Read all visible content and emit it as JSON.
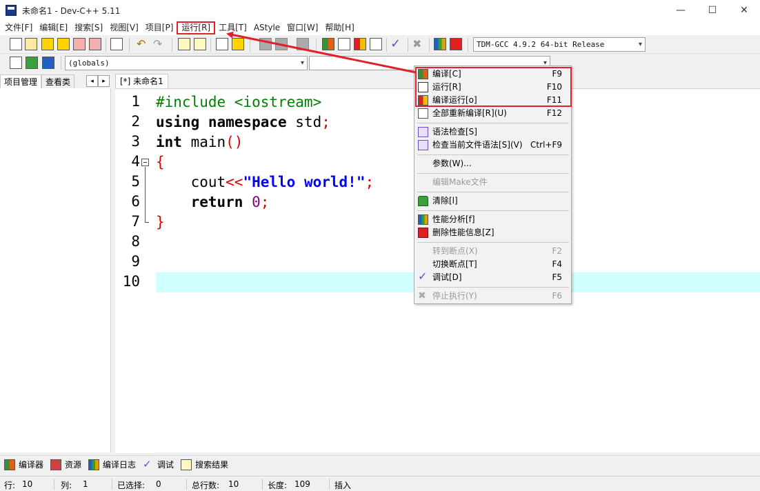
{
  "window": {
    "title": "未命名1 - Dev-C++ 5.11",
    "minimize": "—",
    "maximize": "☐",
    "close": "✕"
  },
  "menu": [
    "文件[F]",
    "编辑[E]",
    "搜索[S]",
    "视图[V]",
    "项目[P]",
    "运行[R]",
    "工具[T]",
    "AStyle",
    "窗口[W]",
    "帮助[H]"
  ],
  "toolbar": {
    "compiler_select": "TDM-GCC 4.9.2 64-bit Release",
    "scope_select": "(globals)",
    "symbol_select": ""
  },
  "left_panel": {
    "tabs": [
      "项目管理",
      "查看类"
    ],
    "prev": "◂",
    "next": "▸"
  },
  "editor": {
    "tab_label": "[*] 未命名1",
    "line_numbers": [
      "1",
      "2",
      "3",
      "4",
      "5",
      "6",
      "7",
      "8",
      "9",
      "10"
    ],
    "active_line": 10
  },
  "run_menu": {
    "items": [
      {
        "label": "编译[C]",
        "shortcut": "F9",
        "icon": "compile-icon",
        "enabled": true
      },
      {
        "label": "运行[R]",
        "shortcut": "F10",
        "icon": "run-icon",
        "enabled": true
      },
      {
        "label": "编译运行[o]",
        "shortcut": "F11",
        "icon": "compile-run-icon",
        "enabled": true
      },
      {
        "label": "全部重新编译[R](U)",
        "shortcut": "F12",
        "icon": "rebuild-all-icon",
        "enabled": true
      },
      {
        "label": "语法检查[S]",
        "shortcut": "",
        "icon": "syntax-check-icon",
        "enabled": true
      },
      {
        "label": "检查当前文件语法[S](V)",
        "shortcut": "Ctrl+F9",
        "icon": "syntax-check-file-icon",
        "enabled": true
      },
      {
        "label": "参数(W)...",
        "shortcut": "",
        "icon": "",
        "enabled": true
      },
      {
        "label": "编辑Make文件",
        "shortcut": "",
        "icon": "",
        "enabled": false
      },
      {
        "label": "清除[l]",
        "shortcut": "",
        "icon": "clean-icon",
        "enabled": true
      },
      {
        "label": "性能分析[f]",
        "shortcut": "",
        "icon": "profile-icon",
        "enabled": true
      },
      {
        "label": "删除性能信息[Z]",
        "shortcut": "",
        "icon": "delete-profile-icon",
        "enabled": true
      },
      {
        "label": "转到断点(X)",
        "shortcut": "F2",
        "icon": "",
        "enabled": false
      },
      {
        "label": "切换断点[T]",
        "shortcut": "F4",
        "icon": "",
        "enabled": true
      },
      {
        "label": "调试[D]",
        "shortcut": "F5",
        "icon": "debug-check-icon",
        "enabled": true
      },
      {
        "label": "停止执行(Y)",
        "shortcut": "F6",
        "icon": "stop-icon",
        "enabled": false
      }
    ]
  },
  "bottom_tabs": [
    "编译器",
    "资源",
    "编译日志",
    "调试",
    "搜索结果"
  ],
  "status": {
    "row_label": "行:",
    "row_value": "10",
    "col_label": "列:",
    "col_value": "1",
    "sel_label": "已选择:",
    "sel_value": "0",
    "total_label": "总行数:",
    "total_value": "10",
    "len_label": "长度:",
    "len_value": "109",
    "mode": "插入"
  },
  "colors": {
    "highlight_red": "#e0202a",
    "active_line": "#cfffff",
    "keyword_string": "#0000ff",
    "preprocessor": "#008000"
  }
}
